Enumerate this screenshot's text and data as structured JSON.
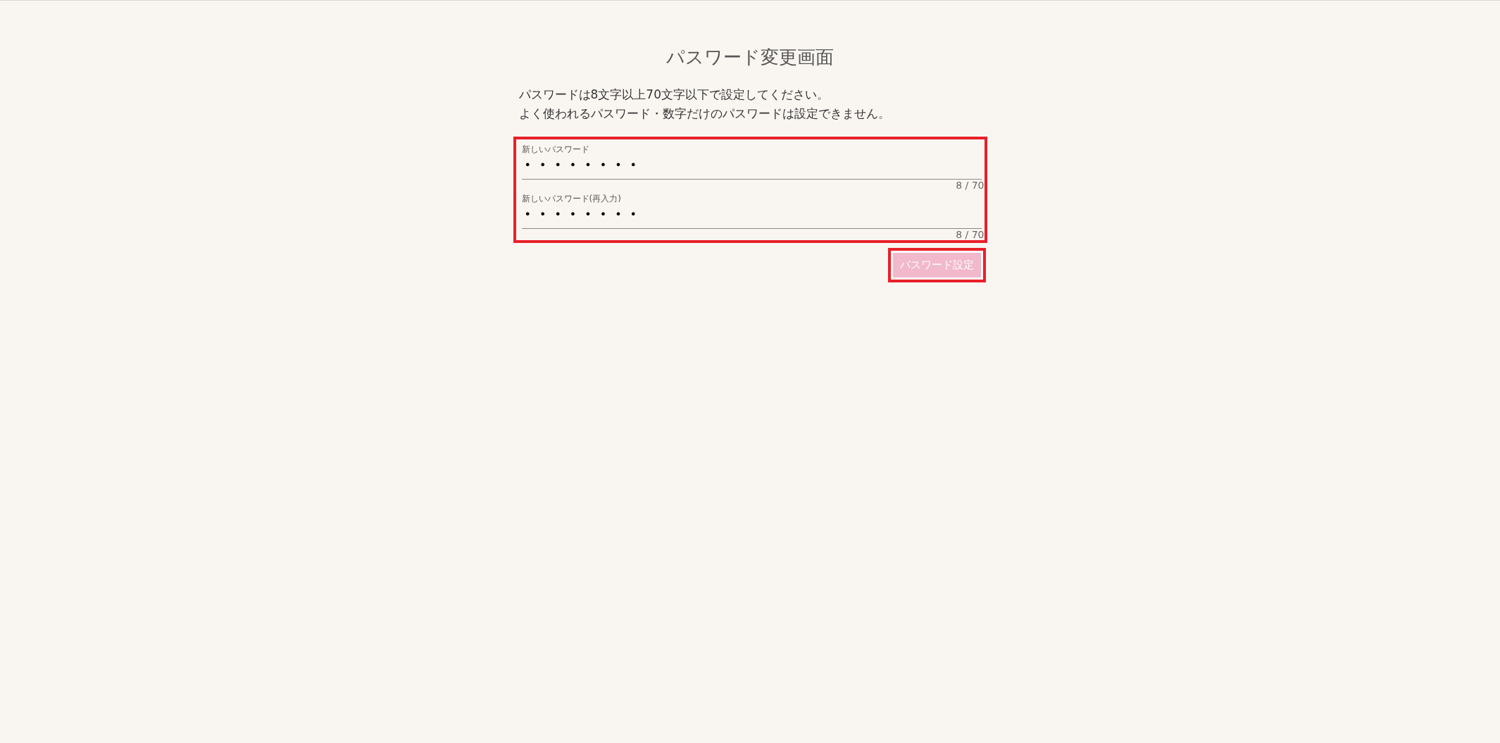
{
  "title": "パスワード変更画面",
  "instructions": [
    "パスワードは8文字以上70文字以下で設定してください。",
    "よく使われるパスワード・数字だけのパスワードは設定できません。"
  ],
  "form": {
    "highlighted": true,
    "fields": [
      {
        "label": "新しいパスワード",
        "value": "••••••••",
        "counter": "8 / 70"
      },
      {
        "label": "新しいパスワード(再入力)",
        "value": "••••••••",
        "counter": "8 / 70"
      }
    ]
  },
  "submit_button": {
    "label": "パスワード設定",
    "disabled": true,
    "highlighted": true
  }
}
